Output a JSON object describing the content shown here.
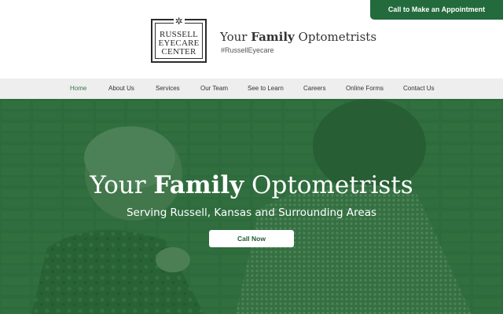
{
  "header": {
    "logo": {
      "line1": "RUSSELL",
      "line2": "EYECARE",
      "line3": "CENTER",
      "mark_icon": "starburst-icon"
    },
    "tagline_pre": "Your ",
    "tagline_bold": "Family",
    "tagline_post": " Optometrists",
    "hashtag": "#RussellEyecare",
    "cta_label": "Call to Make an Appointment"
  },
  "nav": {
    "items": [
      {
        "label": "Home",
        "active": true
      },
      {
        "label": "About Us"
      },
      {
        "label": "Services"
      },
      {
        "label": "Our Team"
      },
      {
        "label": "See to Learn"
      },
      {
        "label": "Careers"
      },
      {
        "label": "Online Forms"
      },
      {
        "label": "Contact Us"
      }
    ]
  },
  "hero": {
    "title_pre": "Your ",
    "title_bold": "Family",
    "title_post": " Optometrists",
    "subtitle": "Serving Russell, Kansas and Surrounding Areas",
    "button_label": "Call Now"
  },
  "colors": {
    "brand_green": "#236b3c",
    "nav_active": "#2f7a4a",
    "nav_bg": "#eeeeee",
    "hero_overlay": "#246836"
  }
}
